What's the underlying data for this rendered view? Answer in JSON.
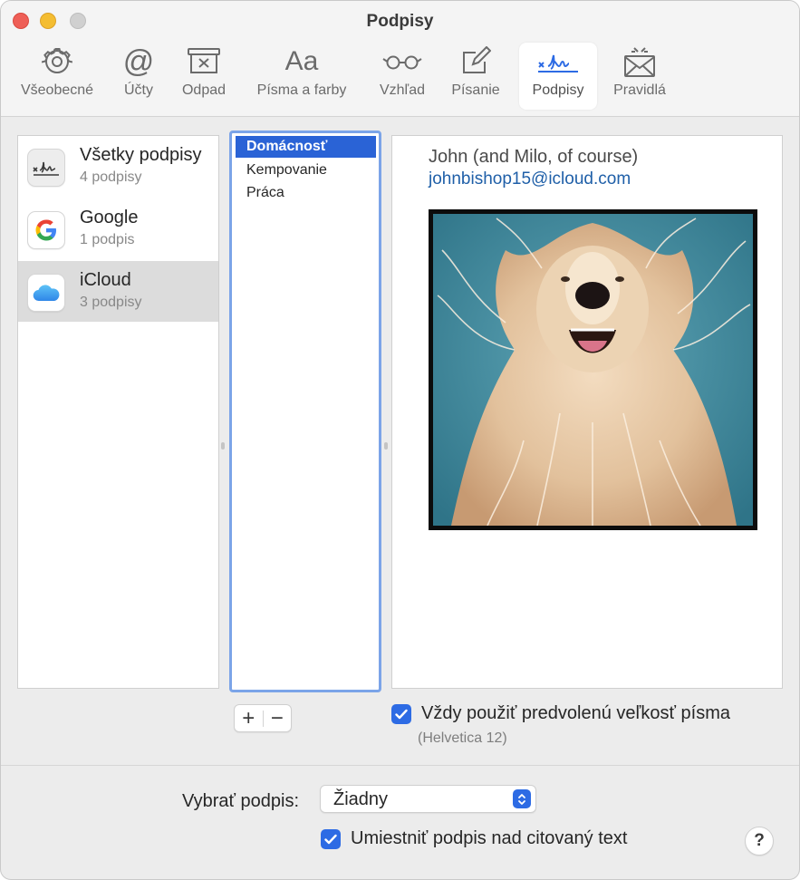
{
  "window": {
    "title": "Podpisy"
  },
  "toolbar": {
    "items": [
      {
        "label": "Všeobecné",
        "icon": "gear-icon"
      },
      {
        "label": "Účty",
        "icon": "at-sign-icon"
      },
      {
        "label": "Odpad",
        "icon": "junk-tray-icon"
      },
      {
        "label": "Písma a farby",
        "icon": "fonts-icon"
      },
      {
        "label": "Vzhľad",
        "icon": "glasses-icon"
      },
      {
        "label": "Písanie",
        "icon": "compose-icon"
      },
      {
        "label": "Podpisy",
        "icon": "signature-icon",
        "active": true
      },
      {
        "label": "Pravidlá",
        "icon": "rules-envelope-icon"
      }
    ]
  },
  "accounts": [
    {
      "name": "Všetky podpisy",
      "count": "4 podpisy",
      "icon": "signature-icon"
    },
    {
      "name": "Google",
      "count": "1 podpis",
      "icon": "google-icon"
    },
    {
      "name": "iCloud",
      "count": "3 podpisy",
      "icon": "icloud-icon",
      "selected": true
    }
  ],
  "signatures": [
    {
      "name": "Domácnosť",
      "selected": true
    },
    {
      "name": "Kempovanie"
    },
    {
      "name": "Práca"
    }
  ],
  "preview": {
    "name": "John (and Milo, of course)",
    "email": "johnbishop15@icloud.com"
  },
  "buttons": {
    "add": "+",
    "remove": "−",
    "help": "?"
  },
  "options": {
    "default_font_label": "Vždy použiť predvolenú veľkosť písma",
    "default_font_checked": true,
    "font_hint": "(Helvetica 12)",
    "choose_label": "Vybrať podpis:",
    "choose_value": "Žiadny",
    "place_above_label": "Umiestniť podpis nad citovaný text",
    "place_above_checked": true
  },
  "colors": {
    "accent": "#2d6be4",
    "selection": "#2a63d6",
    "link": "#1f5fa8"
  }
}
